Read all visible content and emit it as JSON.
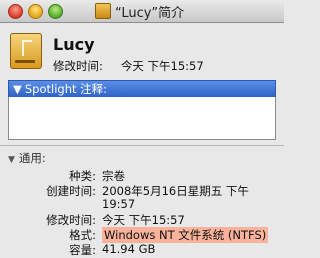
{
  "window": {
    "title": "“Lucy”简介"
  },
  "header": {
    "name": "Lucy",
    "modified_label": "修改时间:",
    "modified_value": "今天 下午15:57",
    "icon": "usb-drive-icon"
  },
  "spotlight": {
    "section_label": "Spotlight 注释:",
    "comment": ""
  },
  "general": {
    "section_label": "通用:",
    "rows": [
      {
        "label": "种类:",
        "value": "宗卷"
      },
      {
        "label": "创建时间:",
        "value": "2008年5月16日星期五 下午"
      },
      {
        "label": "",
        "value": "19:57"
      },
      {
        "label": "修改时间:",
        "value": "今天 下午15:57"
      },
      {
        "label": "格式:",
        "value": "Windows NT 文件系统 (NTFS)"
      },
      {
        "label": "容量:",
        "value": "41.94 GB"
      }
    ]
  },
  "colors": {
    "section_blue": "#2f63c6",
    "format_highlight": "#f9b29b"
  }
}
